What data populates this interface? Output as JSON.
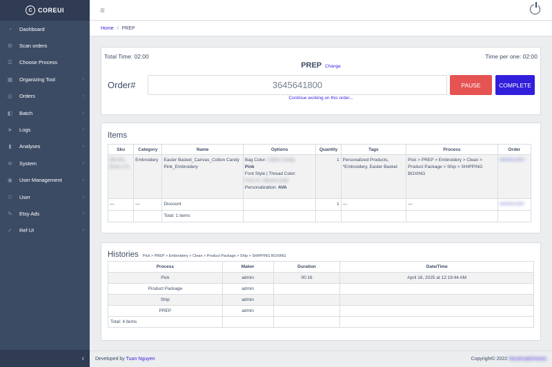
{
  "brand": {
    "logo": "C",
    "name": "COREUI"
  },
  "sidebar": {
    "items": [
      {
        "label": "Dashboard",
        "icon": "speedometer-icon",
        "glyph": "◔",
        "caret": ""
      },
      {
        "label": "Scan orders",
        "icon": "settings-icon",
        "glyph": "⚙",
        "caret": ""
      },
      {
        "label": "Choose Process",
        "icon": "list-icon",
        "glyph": "☰",
        "caret": ""
      },
      {
        "label": "Organizing Tool",
        "icon": "grid-icon",
        "glyph": "▦",
        "caret": "‹"
      },
      {
        "label": "Orders",
        "icon": "cart-icon",
        "glyph": "◎",
        "caret": "‹"
      },
      {
        "label": "Batch",
        "icon": "puzzle-icon",
        "glyph": "◧",
        "caret": "‹"
      },
      {
        "label": "Logs",
        "icon": "cursor-icon",
        "glyph": "➤",
        "caret": "‹"
      },
      {
        "label": "Analyses",
        "icon": "chart-icon",
        "glyph": "▮",
        "caret": "‹"
      },
      {
        "label": "System",
        "icon": "signal-icon",
        "glyph": "≋",
        "caret": "‹"
      },
      {
        "label": "User Management",
        "icon": "globe-icon",
        "glyph": "◉",
        "caret": "‹"
      },
      {
        "label": "User",
        "icon": "user-icon",
        "glyph": "⚇",
        "caret": "‹"
      },
      {
        "label": "Etsy Ads",
        "icon": "pencil-icon",
        "glyph": "✎",
        "caret": "‹"
      },
      {
        "label": "Ref UI",
        "icon": "check-circle-icon",
        "glyph": "✓",
        "caret": "‹"
      }
    ],
    "toggle_glyph": "‹"
  },
  "header": {
    "menu_glyph": "≡"
  },
  "breadcrumb": {
    "home": "Home",
    "separator": "/",
    "current": "PREP"
  },
  "timer": {
    "total_time": "Total Time: 02:00",
    "time_per_one": "Time per one: 02:00",
    "process": "PREP",
    "change_link": "Change",
    "order_label": "Order#",
    "order_value": "3645641800",
    "pause_label": "PAUSE",
    "complete_label": "COMPLETE",
    "continue_link": "Continue working on this order..."
  },
  "items": {
    "title": "Items",
    "columns": [
      "Sku",
      "Category",
      "Name",
      "Options",
      "Quantity",
      "Tags",
      "Process",
      "Order"
    ],
    "row1": {
      "sku_line1": "EB-001-",
      "sku_line2": "Emb-1-01",
      "category": "Embroidery",
      "name": "Easter Basket_Canvas_Cotton Candy Pink_Embroidery",
      "bag_color_label": "Bag Color:",
      "bag_color_value_hidden": "Cotton Candy",
      "bag_color_value": "Pink",
      "font_label": "Font Style | Thread Color:",
      "font_value_hidden": "Font #1 / Mocha Gold",
      "personalization_label": "Personalization:",
      "personalization_value": "AVA",
      "quantity": "1",
      "tags": "Personalized Products, *Embroidery, Easter Basket",
      "process": "Pick > PREP > Embroidery > Clean > Product Package > Ship > SHIPPING BOXING",
      "order": "3645641800"
    },
    "row2": {
      "sku": "—",
      "category": "—",
      "name": "Discount",
      "quantity": "1",
      "tags": "—",
      "process": "—",
      "order": "3645641800"
    },
    "total": "Total: 1 items"
  },
  "histories": {
    "title": "Histories",
    "path": "Pick > PREP > Embroidery > Clean > Product Package > Ship > SHIPPING BOXING",
    "columns": [
      "Process",
      "Maker",
      "Duration",
      "Date/Time"
    ],
    "rows": [
      {
        "process": "Pick",
        "maker": "admin",
        "duration": "00:16",
        "datetime": "April 16, 2025 at 12:19:44 AM"
      },
      {
        "process": "Product Package",
        "maker": "admin",
        "duration": "",
        "datetime": ""
      },
      {
        "process": "Ship",
        "maker": "admin",
        "duration": "",
        "datetime": ""
      },
      {
        "process": "PREP",
        "maker": "admin",
        "duration": "",
        "datetime": ""
      }
    ],
    "total": "Total: 4 items"
  },
  "footer": {
    "developed_by": "Developed by",
    "developer": "Tuan Nguyen",
    "copyright": "Copyright© 2022",
    "owner": "HandmadeHearts"
  },
  "colors": {
    "primary": "#321fdb",
    "danger": "#e55353",
    "sidebar": "#3c4b64"
  }
}
